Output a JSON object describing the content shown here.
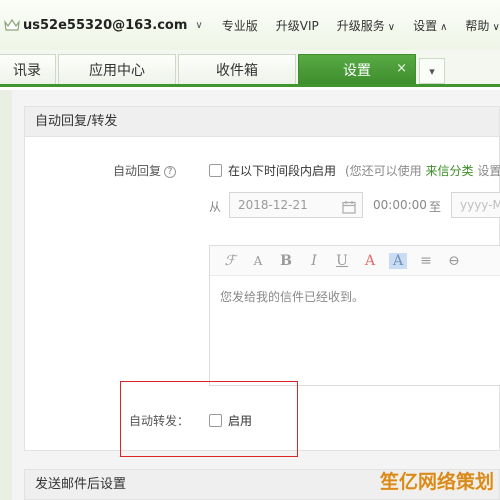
{
  "topbar": {
    "account": "us52e55320@163.com",
    "links": [
      "专业版",
      "升级VIP",
      "升级服务",
      "设置",
      "帮助"
    ]
  },
  "tabs": {
    "items": [
      "讯录",
      "应用中心",
      "收件箱",
      "设置"
    ],
    "active_index": 3,
    "close_glyph": "×",
    "more_glyph": "▾"
  },
  "auto_reply": {
    "section_title": "自动回复/转发",
    "label": "自动回复",
    "checkbox_label": "在以下时间段内启用",
    "hint_prefix": "(您还可以使用",
    "hint_link": "来信分类",
    "hint_suffix": "设置",
    "from_label": "从",
    "start_date": "2018-12-21",
    "start_time": "00:00:00",
    "to_label": "至",
    "end_placeholder": "yyyy-M",
    "toolbar": [
      "ℱ",
      "A",
      "B",
      "I",
      "U",
      "A",
      "A",
      "≡",
      "⊖"
    ],
    "body_text": "您发给我的信件已经收到。"
  },
  "auto_forward": {
    "label": "自动转发：",
    "checkbox_label": "启用"
  },
  "after_send": {
    "section_title": "发送邮件后设置"
  },
  "watermark": "笙亿网络策划",
  "colors": {
    "brand_green": "#41952f",
    "highlight_red": "#d9252a",
    "link_green": "#3b8f25"
  }
}
